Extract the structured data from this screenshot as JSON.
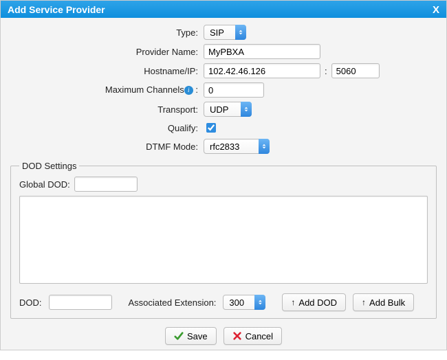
{
  "dialog": {
    "title": "Add Service Provider",
    "close_glyph": "X"
  },
  "form": {
    "type_label": "Type:",
    "type_value": "SIP",
    "provider_name_label": "Provider Name:",
    "provider_name_value": "MyPBXA",
    "hostname_label": "Hostname/IP:",
    "hostname_value": "102.42.46.126",
    "port_separator": ":",
    "port_value": "5060",
    "max_channels_label": "Maximum Channels",
    "max_channels_suffix": ":",
    "max_channels_value": "0",
    "transport_label": "Transport:",
    "transport_value": "UDP",
    "qualify_label": "Qualify:",
    "qualify_checked": true,
    "dtmf_label": "DTMF Mode:",
    "dtmf_value": "rfc2833"
  },
  "dod": {
    "legend": "DOD Settings",
    "global_dod_label": "Global DOD:",
    "global_dod_value": "",
    "dod_label": "DOD:",
    "dod_value": "",
    "assoc_ext_label": "Associated Extension:",
    "assoc_ext_value": "300",
    "add_dod_label": "Add DOD",
    "add_bulk_label": "Add Bulk"
  },
  "footer": {
    "save_label": "Save",
    "cancel_label": "Cancel"
  }
}
